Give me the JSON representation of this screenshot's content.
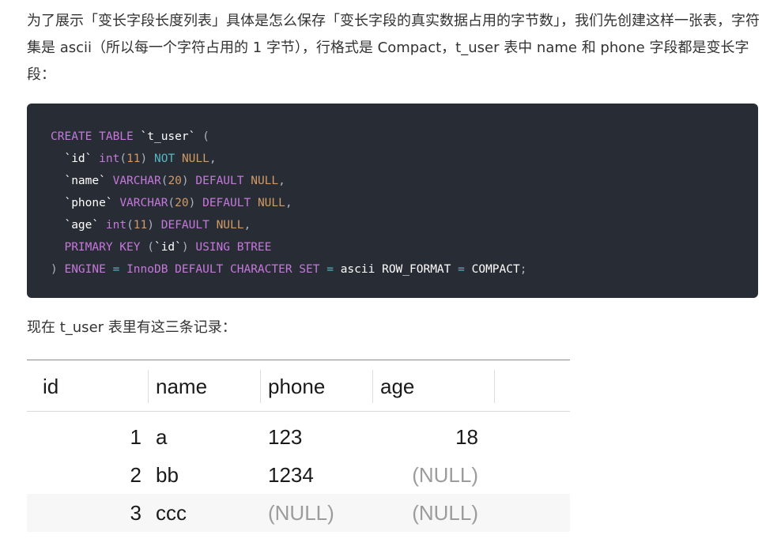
{
  "intro_text": "为了展示「变长字段长度列表」具体是怎么保存「变长字段的真实数据占用的字节数」，我们先创建这样一张表，字符集是 ascii（所以每一个字符占用的 1 字节），行格式是 Compact，t_user 表中 name 和 phone 字段都是变长字段：",
  "code": {
    "line1": [
      "CREATE TABLE",
      " ",
      "`t_user`",
      " ("
    ],
    "line2": [
      "  ",
      "`id`",
      " ",
      "int",
      "(",
      "11",
      ") ",
      "NOT",
      " ",
      "NULL",
      ","
    ],
    "line3": [
      "  ",
      "`name`",
      " ",
      "VARCHAR",
      "(",
      "20",
      ") ",
      "DEFAULT",
      " ",
      "NULL",
      ","
    ],
    "line4": [
      "  ",
      "`phone`",
      " ",
      "VARCHAR",
      "(",
      "20",
      ") ",
      "DEFAULT",
      " ",
      "NULL",
      ","
    ],
    "line5": [
      "  ",
      "`age`",
      " ",
      "int",
      "(",
      "11",
      ") ",
      "DEFAULT",
      " ",
      "NULL",
      ","
    ],
    "line6": [
      "  ",
      "PRIMARY KEY",
      " (",
      "`id`",
      ") ",
      "USING BTREE"
    ],
    "line7": [
      ") ",
      "ENGINE",
      " ",
      "=",
      " ",
      "InnoDB DEFAULT CHARACTER SET",
      " ",
      "=",
      " ",
      "ascii",
      " ",
      "ROW_FORMAT",
      " ",
      "=",
      " ",
      "COMPACT",
      ";"
    ]
  },
  "after_text": "现在 t_user 表里有这三条记录：",
  "table": {
    "headers": [
      "id",
      "name",
      "phone",
      "age"
    ],
    "rows": [
      [
        "1",
        "a",
        "123",
        "18"
      ],
      [
        "2",
        "bb",
        "1234",
        "(NULL)"
      ],
      [
        "3",
        "ccc",
        "(NULL)",
        "(NULL)"
      ]
    ]
  },
  "colors": {
    "code_bg": "#282c34",
    "keyword": "#c678dd",
    "number": "#d19a66",
    "operator": "#56b6c2",
    "null_text": "#9c9c9c"
  }
}
